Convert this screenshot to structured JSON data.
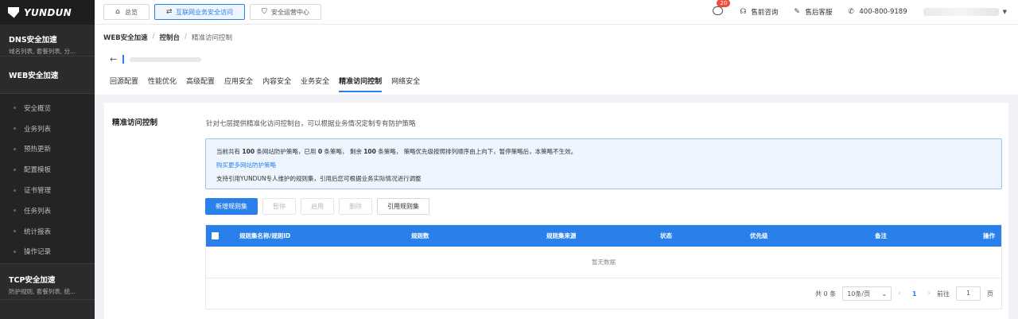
{
  "brand": {
    "name": "YUNDUN"
  },
  "sidebar": {
    "dns": {
      "title": "DNS安全加速",
      "sub": "域名列表, 套餐列表, 分..."
    },
    "web": {
      "title": "WEB安全加速"
    },
    "items": [
      {
        "label": "安全概览"
      },
      {
        "label": "业务列表"
      },
      {
        "label": "预热更新"
      },
      {
        "label": "配置模板"
      },
      {
        "label": "证书管理"
      },
      {
        "label": "任务列表"
      },
      {
        "label": "统计报表"
      },
      {
        "label": "操作记录"
      }
    ],
    "tcp": {
      "title": "TCP安全加速",
      "sub": "防护规则, 套餐列表, 统..."
    }
  },
  "topbar": {
    "tabs": [
      {
        "label": "总览",
        "icon": "home-icon"
      },
      {
        "label": "互联网业务安全访问",
        "icon": "link-icon"
      },
      {
        "label": "安全运营中心",
        "icon": "shield-icon"
      }
    ],
    "notification_count": "20",
    "presale": "售前咨询",
    "aftersale": "售后客服",
    "phone": "400-800-9189"
  },
  "breadcrumb": {
    "root": "WEB安全加速",
    "mid": "控制台",
    "current": "精准访问控制"
  },
  "subtabs": [
    {
      "label": "回源配置"
    },
    {
      "label": "性能优化"
    },
    {
      "label": "高级配置"
    },
    {
      "label": "应用安全"
    },
    {
      "label": "内容安全"
    },
    {
      "label": "业务安全"
    },
    {
      "label": "精准访问控制"
    },
    {
      "label": "网络安全"
    }
  ],
  "panel": {
    "title": "精准访问控制",
    "desc": "针对七层提供精准化访问控制台，可以根据业务情况定制专有防护策略",
    "notice": {
      "p1": "当前共有 ",
      "total": "100",
      "p2": " 条网站防护策略，已用 ",
      "used": "0",
      "p3": " 条策略， 剩余 ",
      "remain": "100",
      "p4": " 条策略， 策略优先级按照排列顺序由上向下，暂停策略后，本策略不生效。",
      "link": "购买更多网站防护策略",
      "line3": "支持引用YUNDUN专人维护的规则集，引用后您可根据业务实际情况进行调整"
    },
    "buttons": {
      "add": "新增规则集",
      "pause": "暂停",
      "enable": "启用",
      "delete": "删除",
      "reference": "引用规则集"
    },
    "table": {
      "columns": [
        "规则集名称/规则ID",
        "规则数",
        "规则集来源",
        "状态",
        "优先级",
        "备注",
        "操作"
      ],
      "empty": "暂无数据"
    },
    "pager": {
      "total": "共 0 条",
      "page_size": "10条/页",
      "current_page": "1",
      "goto": "前往",
      "goto_value": "1",
      "page_unit": "页"
    }
  },
  "colors": {
    "accent": "#2a80eb",
    "sidebar": "#2b2b2b",
    "badge": "#f04b3b"
  }
}
